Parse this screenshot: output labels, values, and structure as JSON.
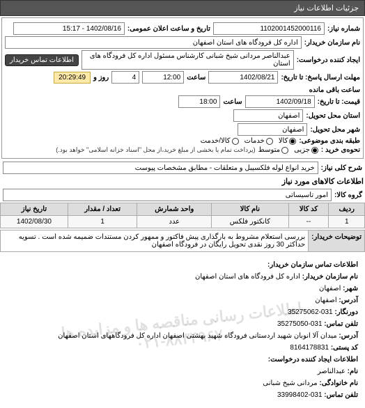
{
  "header": {
    "title": "جزئیات اطلاعات نیاز"
  },
  "form": {
    "request_no_label": "شماره نیاز:",
    "request_no": "1102001452000116",
    "announce_label": "تاریخ و ساعت اعلان عمومی:",
    "announce_value": "1402/08/16 - 15:17",
    "buyer_title_label": "نام سازمان خریدار:",
    "buyer_title": "اداره کل فرودگاه های استان اصفهان",
    "creator_label": "ایجاد کننده درخواست:",
    "creator": "عبدالناصر مردانی شیخ شبانی  کارشناس مسئول  اداره کل فرودگاه های استان",
    "contact_btn": "اطلاعات تماس خریدار",
    "deadline_label": "مهلت ارسال پاسخ: تا تاریخ:",
    "deadline_date": "1402/08/21",
    "time_label": "ساعت",
    "deadline_time": "12:00",
    "remain_days_val": "4",
    "remain_days_label": "روز و",
    "remain_time": "20:29:49",
    "remain_suffix": "ساعت باقی مانده",
    "quote_to_label": "قیمت: تا تاریخ:",
    "quote_date": "1402/09/18",
    "quote_time": "18:00",
    "province_label": "استان محل تحویل:",
    "province": "اصفهان",
    "city_label": "شهر محل تحویل:",
    "city": "اصفهان",
    "package_label": "طبقه بندی موضوعی:",
    "package_options": {
      "kala": "کالا",
      "khadamat": "خدمات",
      "both": "کالا/خدمت"
    },
    "package_selected": "kala",
    "purchase_label": "نحوه‌ی خرید :",
    "purchase_options": {
      "jozi": "جزیی",
      "motavaset": "متوسط"
    },
    "purchase_selected": "jozi",
    "purchase_note": "(پرداخت تمام یا بخشی از مبلغ خرید،از محل \"اسناد خزانه اسلامی\" خواهد بود.)",
    "subject_label": "شرح کلی نیاز:",
    "subject": "خرید انواع لوله فلکسیبل و متعلقات - مطابق مشخصات پیوست"
  },
  "goods": {
    "title": "اطلاعات کالاهای مورد نیاز",
    "group_label": "گروه کالا:",
    "group_value": "امور تاسیساتی",
    "columns": {
      "row": "ردیف",
      "code": "کد کالا",
      "name": "نام کالا",
      "unit": "واحد شمارش",
      "qty": "تعداد / مقدار",
      "date": "تاریخ نیاز"
    },
    "rows": [
      {
        "row": "1",
        "code": "--",
        "name": "کانکتور فلکس",
        "unit": "عدد",
        "qty": "1",
        "date": "1402/08/30"
      }
    ],
    "note_label": "توضیحات خریدار:",
    "note": "بررسی استعلام مشروط به بارگذاری پیش فاکتور و ممهور کردن مستندات ضمیمه شده است . تسویه حداکثر 30 روز نقدی تحویل رایگان در فرودگاه اصفهان"
  },
  "watermark": {
    "line1": "اطلاعات رسانی مناقصه ها و مزایده ها",
    "line2": "۰۲۱-۸۸۳۴۹۶۷۰"
  },
  "contact": {
    "title": "اطلاعات تماس سازمان خریدار:",
    "org_label": "نام سازمان خریدار:",
    "org": "اداره کل فرودگاه های استان اصفهان",
    "city_label": "شهر:",
    "city": "اصفهان",
    "addr_label": "آدرس:",
    "addr": "اصفهان",
    "fax_label": "دورنگار:",
    "fax": "031-35275062",
    "tel_label": "تلفن تماس:",
    "tel": "031-35275050",
    "address2_label": "آدرس:",
    "address2": "میدان آلا انوبان شهید اردستانی فرودگاه شهید بهشتی اصفهان اداره کل فرودگاههای استان اصفهان",
    "postal_label": "کد پستی:",
    "postal": "8164178831",
    "req_contact_title": "اطلاعات ایجاد کننده درخواست:",
    "name_label": "نام:",
    "name": "عبدالناصر",
    "family_label": "نام خانوادگی:",
    "family": "مردانی شیخ شبانی",
    "tel2_label": "تلفن تماس:",
    "tel2": "031-33998402"
  }
}
